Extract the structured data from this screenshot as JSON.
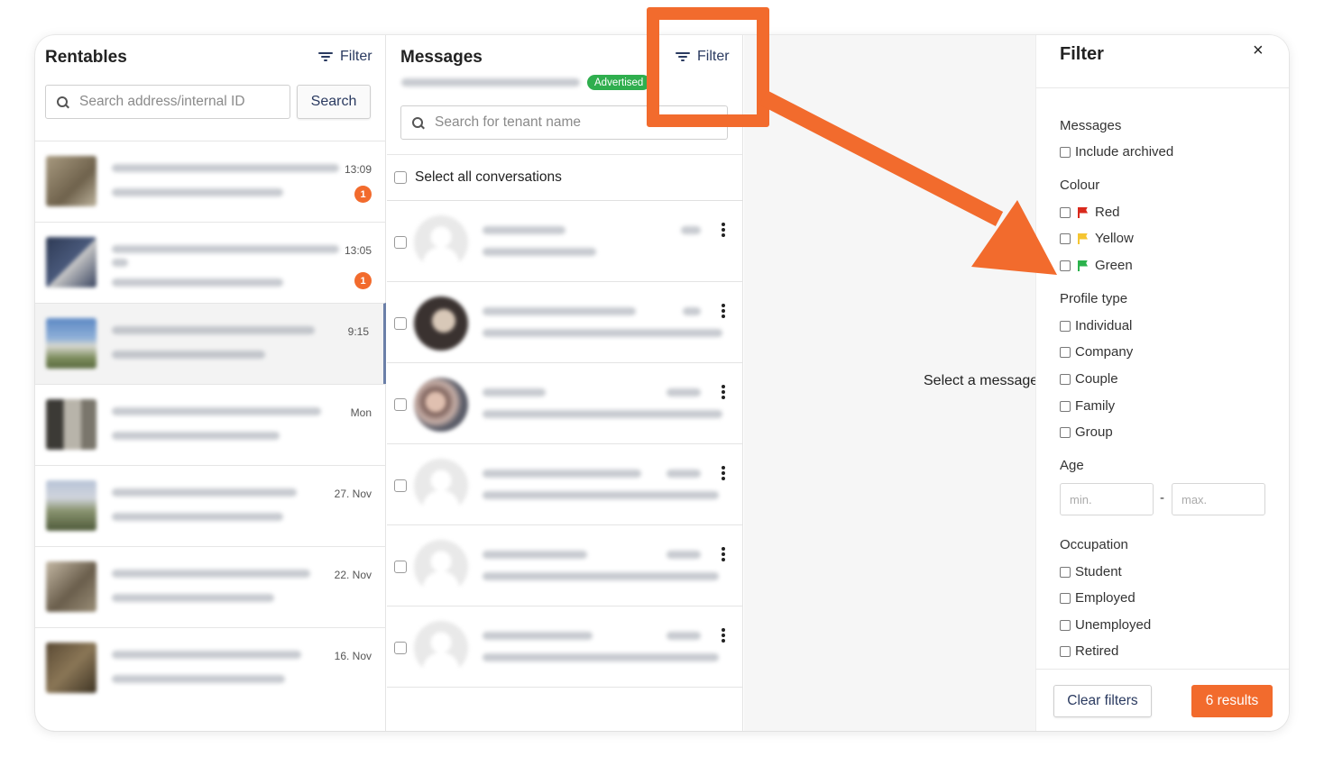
{
  "rentables": {
    "title": "Rentables",
    "filter_label": "Filter",
    "search_placeholder": "Search address/internal ID",
    "search_button": "Search",
    "items": [
      {
        "time": "13:09",
        "badge": "1",
        "thumb_color": "#8a7a62"
      },
      {
        "time": "13:05",
        "badge": "1",
        "thumb_color": "#3c4a66"
      },
      {
        "time": "9:15",
        "badge": "",
        "thumb_color": "#6b8fb8"
      },
      {
        "time": "Mon",
        "badge": "",
        "thumb_color": "#5a544c"
      },
      {
        "time": "27. Nov",
        "badge": "",
        "thumb_color": "#7a8a70"
      },
      {
        "time": "22. Nov",
        "badge": "",
        "thumb_color": "#8a7c6a"
      },
      {
        "time": "16. Nov",
        "badge": "",
        "thumb_color": "#6e5c44"
      }
    ]
  },
  "messages": {
    "title": "Messages",
    "filter_label": "Filter",
    "advertised_badge": "Advertised",
    "search_placeholder": "Search for tenant name",
    "select_all_label": "Select all conversations",
    "items": [
      {
        "avatar": "placeholder"
      },
      {
        "avatar": "photo",
        "avatar_color": "#3a3230"
      },
      {
        "avatar": "photo",
        "avatar_color": "#7a5e58"
      },
      {
        "avatar": "placeholder"
      },
      {
        "avatar": "placeholder"
      },
      {
        "avatar": "placeholder"
      }
    ]
  },
  "center": {
    "empty_text": "Select a message"
  },
  "filter_panel": {
    "title": "Filter",
    "close_glyph": "×",
    "messages_label": "Messages",
    "include_archived": "Include archived",
    "colour_label": "Colour",
    "colours": [
      {
        "label": "Red",
        "color": "#d9291c"
      },
      {
        "label": "Yellow",
        "color": "#f5c531"
      },
      {
        "label": "Green",
        "color": "#2bb24c"
      }
    ],
    "profile_type_label": "Profile type",
    "profile_types": [
      "Individual",
      "Company",
      "Couple",
      "Family",
      "Group"
    ],
    "age_label": "Age",
    "age_min_placeholder": "min.",
    "age_separator": "-",
    "age_max_placeholder": "max.",
    "occupation_label": "Occupation",
    "occupations": [
      "Student",
      "Employed",
      "Unemployed",
      "Retired"
    ],
    "clear_button": "Clear filters",
    "results_button": "6 results"
  },
  "annotation": {
    "accent_color": "#f26b2d"
  }
}
